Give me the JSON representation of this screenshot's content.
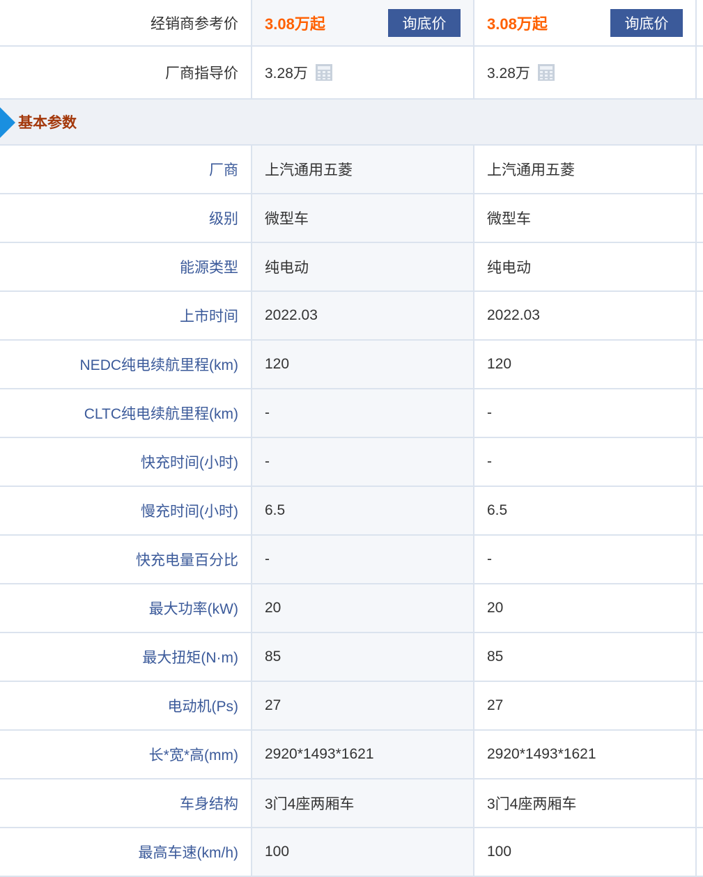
{
  "pricing": {
    "dealer_label": "经销商参考价",
    "dealer_prices": [
      "3.08万起",
      "3.08万起"
    ],
    "ask_button_label": "询底价",
    "guide_label": "厂商指导价",
    "guide_prices": [
      "3.28万",
      "3.28万"
    ]
  },
  "section": {
    "title": "基本参数"
  },
  "rows": [
    {
      "label": "厂商",
      "values": [
        "上汽通用五菱",
        "上汽通用五菱"
      ],
      "link": true
    },
    {
      "label": "级别",
      "values": [
        "微型车",
        "微型车"
      ],
      "link": true
    },
    {
      "label": "能源类型",
      "values": [
        "纯电动",
        "纯电动"
      ],
      "link": true
    },
    {
      "label": "上市时间",
      "values": [
        "2022.03",
        "2022.03"
      ],
      "link": true
    },
    {
      "label": "NEDC纯电续航里程(km)",
      "values": [
        "120",
        "120"
      ],
      "link": true
    },
    {
      "label": "CLTC纯电续航里程(km)",
      "values": [
        "-",
        "-"
      ],
      "link": true
    },
    {
      "label": "快充时间(小时)",
      "values": [
        "-",
        "-"
      ],
      "link": true
    },
    {
      "label": "慢充时间(小时)",
      "values": [
        "6.5",
        "6.5"
      ],
      "link": true
    },
    {
      "label": "快充电量百分比",
      "values": [
        "-",
        "-"
      ],
      "link": true
    },
    {
      "label": "最大功率(kW)",
      "values": [
        "20",
        "20"
      ],
      "link": true
    },
    {
      "label": "最大扭矩(N·m)",
      "values": [
        "85",
        "85"
      ],
      "link": true
    },
    {
      "label": "电动机(Ps)",
      "values": [
        "27",
        "27"
      ],
      "link": true
    },
    {
      "label": "长*宽*高(mm)",
      "values": [
        "2920*1493*1621",
        "2920*1493*1621"
      ],
      "link": true
    },
    {
      "label": "车身结构",
      "values": [
        "3门4座两厢车",
        "3门4座两厢车"
      ],
      "link": true
    },
    {
      "label": "最高车速(km/h)",
      "values": [
        "100",
        "100"
      ],
      "link": true
    }
  ]
}
